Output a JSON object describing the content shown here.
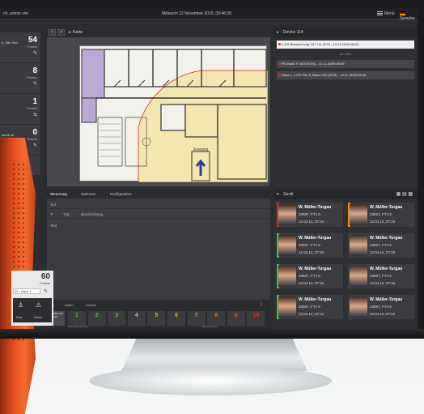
{
  "topbar": {
    "user": "ch, admin von",
    "clock": "Mittwoch 12 November 2015, 09:48:28",
    "menu_label": "Menü",
    "lang_label": "Sprache"
  },
  "leftcol": {
    "counters": [
      {
        "label": "n, 3rth Tact",
        "value": "54",
        "sub": "Prozess",
        "icon": "pen-icon"
      },
      {
        "label": "",
        "value": "8",
        "sub": "Prozess",
        "icon": "pen-icon"
      },
      {
        "label": "",
        "value": "1",
        "sub": "Prozess",
        "icon": "pen-icon"
      },
      {
        "label": "alone ok",
        "value": "0",
        "sub": "Prozess",
        "icon": "pen-icon"
      }
    ]
  },
  "map": {
    "title": "Karte",
    "nav_prev": "<",
    "nav_next": ">",
    "entrance_label": "Eingang"
  },
  "events": {
    "title": "Device 114",
    "alerts": [
      "1.OG Besprechung V37 Tür (ICS) - 13.11.15/09:48:20",
      "PS-Hand T7.003 (SOS) - 13.11.15/09:45:09",
      "Haus 1, 1.OG Flur 5, Raum 120 (SOS) - 13.11.15/09:03:06"
    ],
    "divider": "Ab Stille"
  },
  "list": {
    "tabs": [
      "Steuerung",
      "Optionen",
      "Konfiguration"
    ],
    "id": "114",
    "columns": [
      "Typ",
      "Beschreibung"
    ],
    "first": "Text"
  },
  "widget": {
    "value": "60",
    "label": "Prozess",
    "select": "12 - Haus 1",
    "btn1": "Eintr.",
    "btn2": "Aktion"
  },
  "prio": {
    "top_left": "Daten",
    "top_mid": "Bericht",
    "header": "Sender mit Schuh",
    "sub_left": "Automatischer Ruf",
    "sub_right": "Manueller Ruf",
    "buttons": [
      {
        "n": "1",
        "color": "#4cbf3a"
      },
      {
        "n": "2",
        "color": "#4cbf3a"
      },
      {
        "n": "3",
        "color": "#66c43a"
      },
      {
        "n": "4",
        "color": "#b8c93a"
      },
      {
        "n": "5",
        "color": "#e0b52a"
      },
      {
        "n": "6",
        "color": "#e0a52a"
      },
      {
        "n": "7",
        "color": "#e08a2a"
      },
      {
        "n": "8",
        "color": "#e07028"
      },
      {
        "n": "9",
        "color": "#e04a28"
      },
      {
        "n": "10",
        "color": "#e03026"
      }
    ]
  },
  "staff": {
    "title": "Gerät",
    "cards": [
      {
        "name": "W. Müller-Turgau",
        "l2": "33567, FT4 9",
        "l3": "12.04.14, 07:34",
        "stripe": "#d62b2b"
      },
      {
        "name": "W. Müller-Turgau",
        "l2": "33567, FT4 9",
        "l3": "12.04.14, 07:34",
        "stripe": "#f08a1e"
      },
      {
        "name": "W. Müller-Turgau",
        "l2": "33567, FT4 9",
        "l3": "12.04.14, 07:34",
        "stripe": "#4cbf3a"
      },
      {
        "name": "W. Müller-Turgau",
        "l2": "33567, FT4 9",
        "l3": "12.04.14, 07:34",
        "stripe": "#3b3c40"
      },
      {
        "name": "W. Müller-Turgau",
        "l2": "33567, FT4 9",
        "l3": "12.04.14, 07:34",
        "stripe": "#4cbf3a"
      },
      {
        "name": "W. Müller-Turgau",
        "l2": "33567, FT4 9",
        "l3": "12.04.14, 07:34",
        "stripe": "#3b3c40"
      },
      {
        "name": "W. Müller-Turgau",
        "l2": "33567, FT4 9",
        "l3": "12.04.14, 07:34",
        "stripe": "#4cbf3a"
      },
      {
        "name": "W. Müller-Turgau",
        "l2": "33567, FT4 9",
        "l3": "12.04.14, 07:34",
        "stripe": "#3b3c40"
      }
    ]
  }
}
